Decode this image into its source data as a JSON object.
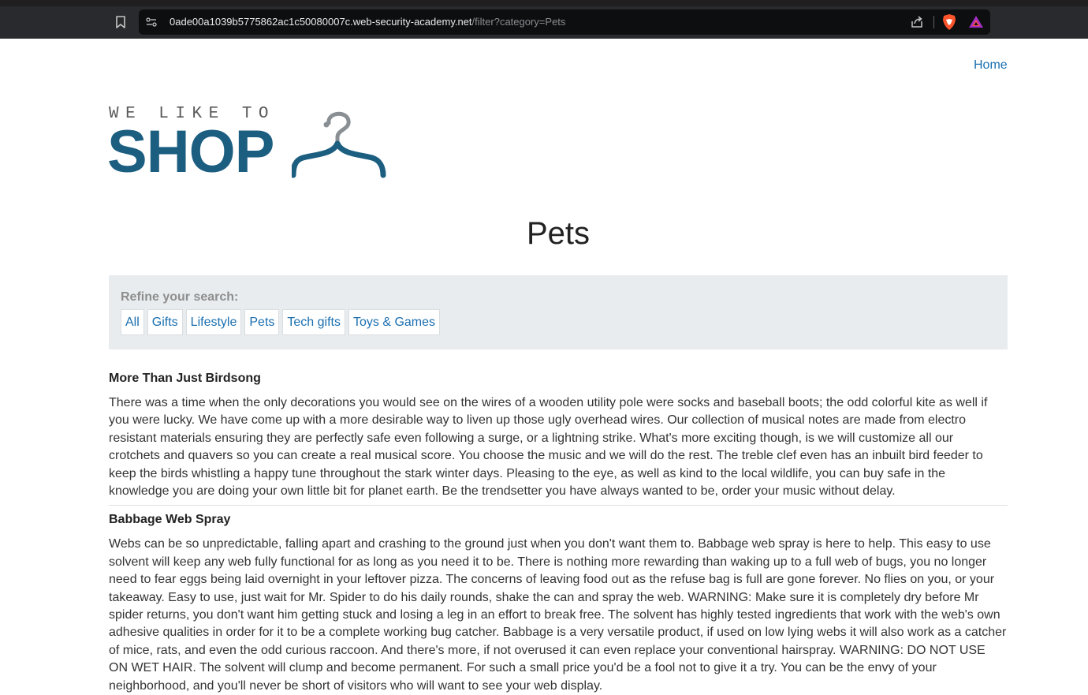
{
  "browser": {
    "url_host": "0ade00a1039b5775862ac1c50080007c.web-security-academy.net",
    "url_path": "/filter?category=Pets",
    "icons": [
      "bookmark-icon",
      "site-info-icon",
      "share-icon",
      "brave-shield-icon",
      "brave-rewards-icon"
    ]
  },
  "nav": {
    "home_label": "Home"
  },
  "logo": {
    "small_text": "WE LIKE TO",
    "big_text": "SHOP",
    "icon": "hanger-icon"
  },
  "page": {
    "title": "Pets"
  },
  "filter": {
    "label": "Refine your search:",
    "categories": [
      "All",
      "Gifts",
      "Lifestyle",
      "Pets",
      "Tech gifts",
      "Toys & Games"
    ]
  },
  "products": [
    {
      "name": "More Than Just Birdsong",
      "description": "There was a time when the only decorations you would see on the wires of a wooden utility pole were socks and baseball boots; the odd colorful kite as well if you were lucky. We have come up with a more desirable way to liven up those ugly overhead wires. Our collection of musical notes are made from electro resistant materials ensuring they are perfectly safe even following a surge, or a lightning strike. What's more exciting though, is we will customize all our crotchets and quavers so you can create a real musical score. You choose the music and we will do the rest. The treble clef even has an inbuilt bird feeder to keep the birds whistling a happy tune throughout the stark winter days. Pleasing to the eye, as well as kind to the local wildlife, you can buy safe in the knowledge you are doing your own little bit for planet earth. Be the trendsetter you have always wanted to be, order your music without delay."
    },
    {
      "name": "Babbage Web Spray",
      "description": "Webs can be so unpredictable, falling apart and crashing to the ground just when you don't want them to. Babbage web spray is here to help. This easy to use solvent will keep any web fully functional for as long as you need it to be. There is nothing more rewarding than waking up to a full web of bugs, you no longer need to fear eggs being laid overnight in your leftover pizza. The concerns of leaving food out as the refuse bag is full are gone forever. No flies on you, or your takeaway. Easy to use, just wait for Mr. Spider to do his daily rounds, shake the can and spray the web. WARNING: Make sure it is completely dry before Mr spider returns, you don't want him getting stuck and losing a leg in an effort to break free. The solvent has highly tested ingredients that work with the web's own adhesive qualities in order for it to be a complete working bug catcher. Babbage is a very versatile product, if used on low lying webs it will also work as a catcher of mice, rats, and even the odd curious raccoon. And there's more, if not overused it can even replace your conventional hairspray. WARNING: DO NOT USE ON WET HAIR. The solvent will clump and become permanent. For such a small price you'd be a fool not to give it a try. You can be the envy of your neighborhood, and you'll never be short of visitors who will want to see your web display."
    }
  ],
  "colors": {
    "link": "#1a6fb0",
    "logo_blue": "#1b5e80",
    "filter_bg": "#e8ecef",
    "chrome_bg": "#292a2d"
  }
}
